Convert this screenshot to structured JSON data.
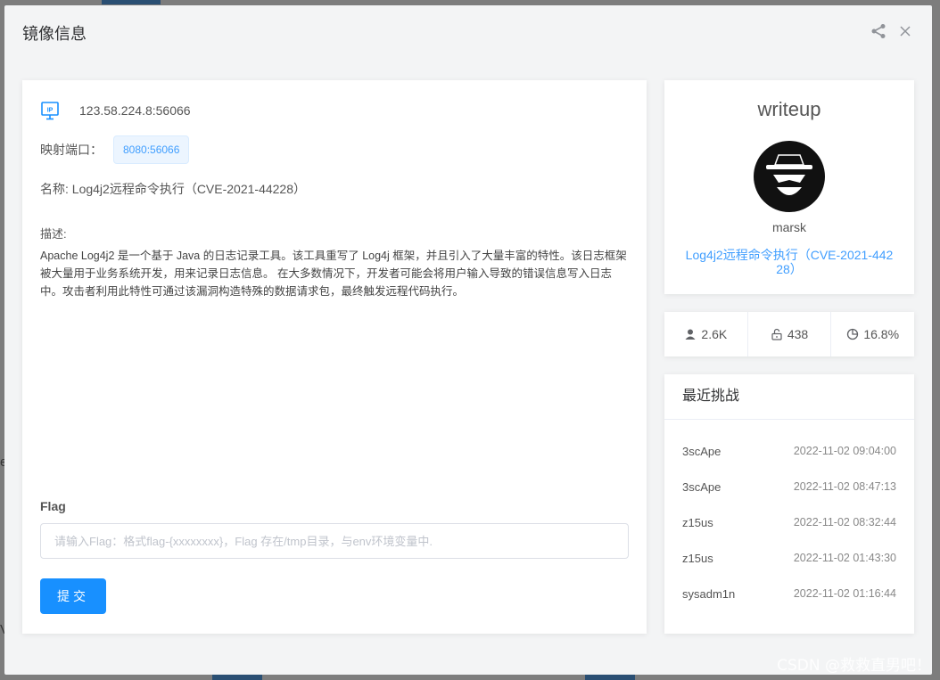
{
  "dialog": {
    "title": "镜像信息"
  },
  "info": {
    "ip": "123.58.224.8:56066",
    "port_label": "映射端口：",
    "port_value": "8080:56066",
    "name": "名称: Log4j2远程命令执行（CVE-2021-44228）",
    "desc_label": "描述:",
    "description": "Apache Log4j2 是一个基于 Java 的日志记录工具。该工具重写了 Log4j 框架，并且引入了大量丰富的特性。该日志框架被大量用于业务系统开发，用来记录日志信息。 在大多数情况下，开发者可能会将用户输入导致的错误信息写入日志中。攻击者利用此特性可通过该漏洞构造特殊的数据请求包，最终触发远程代码执行。"
  },
  "flag": {
    "label": "Flag",
    "placeholder": "请输入Flag：格式flag-{xxxxxxxx}，Flag 存在/tmp目录，与env环境变量中.",
    "submit_label": "提交"
  },
  "profile": {
    "title": "writeup",
    "author": "marsk",
    "challenge": "Log4j2远程命令执行（CVE-2021-44228）"
  },
  "stats": {
    "users": "2.6K",
    "solves": "438",
    "rate": "16.8%"
  },
  "recent": {
    "header": "最近挑战",
    "rows": [
      {
        "user": "3scApe",
        "time": "2022-11-02 09:04:00"
      },
      {
        "user": "3scApe",
        "time": "2022-11-02 08:47:13"
      },
      {
        "user": "z15us",
        "time": "2022-11-02 08:32:44"
      },
      {
        "user": "z15us",
        "time": "2022-11-02 01:43:30"
      },
      {
        "user": "sysadm1n",
        "time": "2022-11-02 01:16:44"
      }
    ]
  },
  "background": {
    "edge_letter": "e",
    "edge_letter_2": "V"
  },
  "watermark": "CSDN @救救直男吧！",
  "colors": {
    "primary": "#1890ff",
    "link": "#409eff",
    "tag_bg": "#ecf5ff"
  }
}
